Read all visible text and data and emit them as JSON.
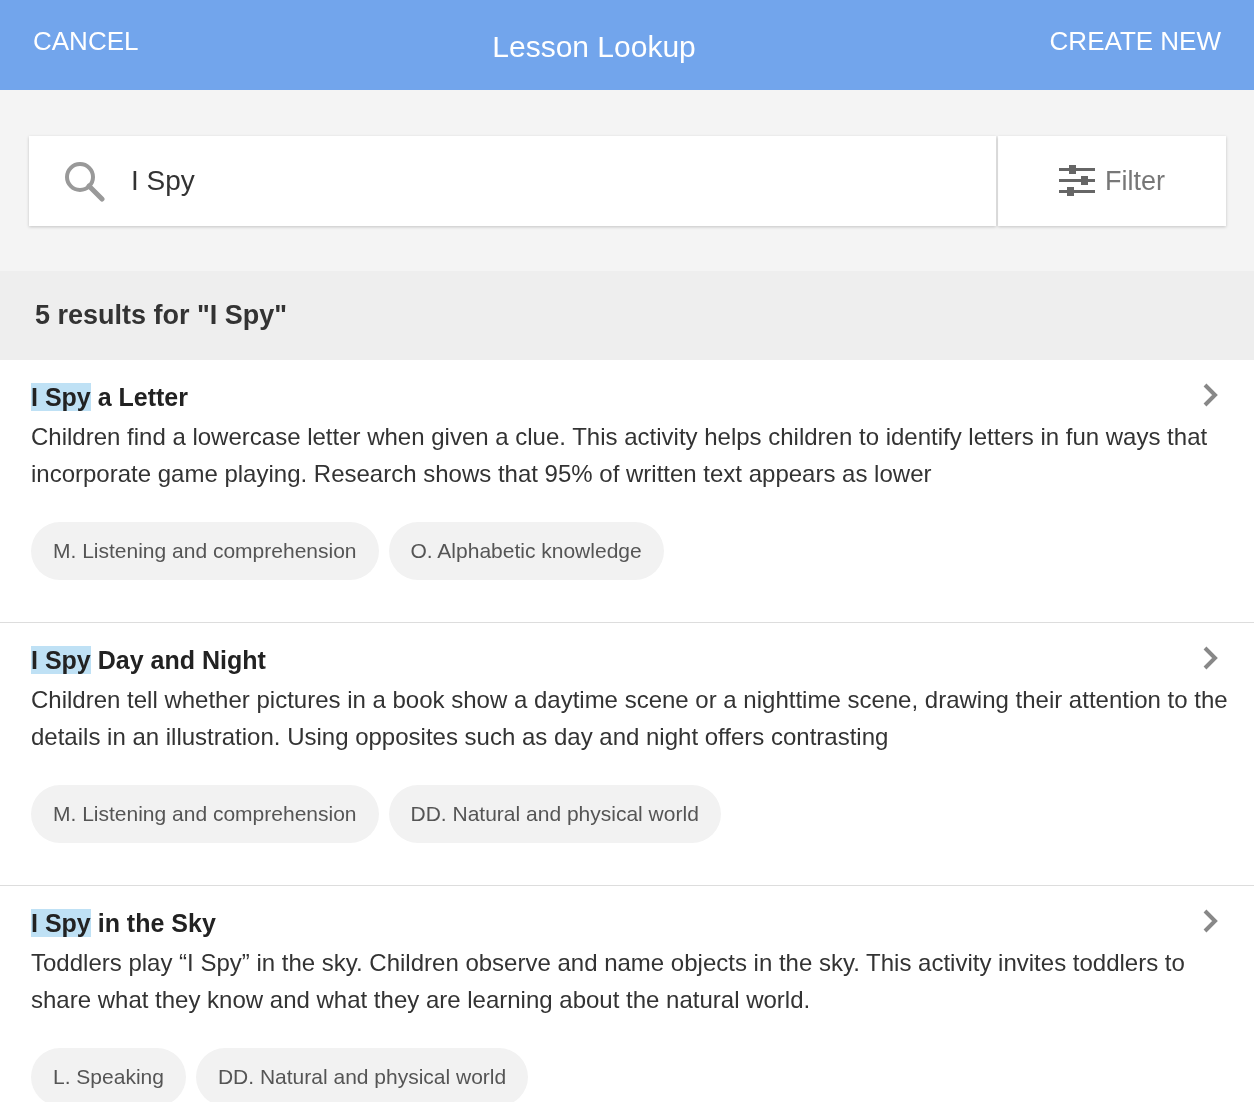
{
  "header": {
    "cancel": "CANCEL",
    "title": "Lesson Lookup",
    "create": "CREATE NEW"
  },
  "search": {
    "value": "I Spy",
    "filter": "Filter"
  },
  "results_heading": "5 results for \"I Spy\"",
  "results": [
    {
      "highlight": "I Spy",
      "title_rest": " a Letter",
      "description": "Children find a lowercase letter when given a clue. This activity helps children to identify letters in fun ways that incorporate game playing. Research shows that 95% of written text appears as lower",
      "tags": [
        "M. Listening and comprehension",
        "O. Alphabetic knowledge"
      ]
    },
    {
      "highlight": "I Spy",
      "title_rest": " Day and Night",
      "description": "Children tell whether pictures in a book show a daytime scene or a nighttime scene, drawing their attention to the details in an illustration. Using opposites such as day and night offers contrasting",
      "tags": [
        "M. Listening and comprehension",
        "DD. Natural and physical world"
      ]
    },
    {
      "highlight": "I Spy",
      "title_rest": " in the Sky",
      "description": "Toddlers play “I Spy” in the sky. Children observe and name objects in the sky. This activity invites toddlers to share what they know and what they are learning about the natural world.",
      "tags": [
        "L. Speaking",
        "DD. Natural and physical world"
      ]
    }
  ]
}
